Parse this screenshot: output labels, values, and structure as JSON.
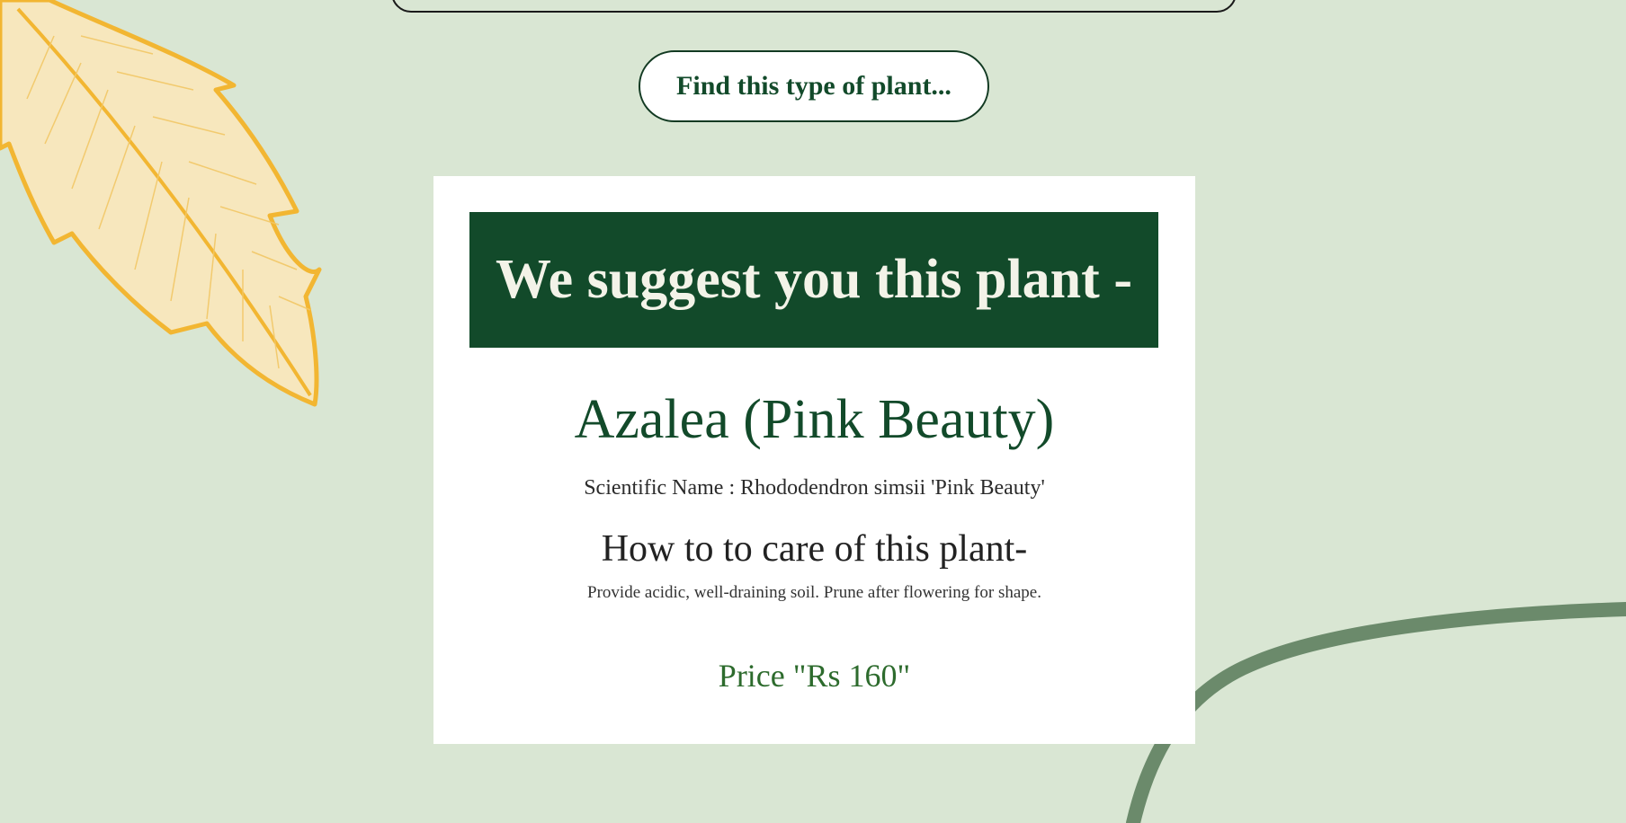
{
  "search": {
    "value": ""
  },
  "find_button": {
    "label": "Find this type of plant..."
  },
  "suggestion": {
    "banner_text": "We suggest you this plant -",
    "plant_name": "Azalea (Pink Beauty)",
    "scientific_label": "Scientific Name : ",
    "scientific_name": "Rhododendron simsii 'Pink Beauty'",
    "care_heading": "How to to care of this plant-",
    "care_text": "Provide acidic, well-draining soil. Prune after flowering for shape.",
    "price_label": "Price ",
    "price_value": "\"Rs 160\""
  },
  "colors": {
    "background": "#d9e6d3",
    "brand_green": "#124a2a",
    "price_green": "#2d6b2d",
    "leaf_yellow": "#f2b632",
    "stem_green": "#6b8a6b"
  },
  "icons": {
    "leaf": "yellow-leaf-decoration",
    "stem": "curved-stem-decoration"
  }
}
